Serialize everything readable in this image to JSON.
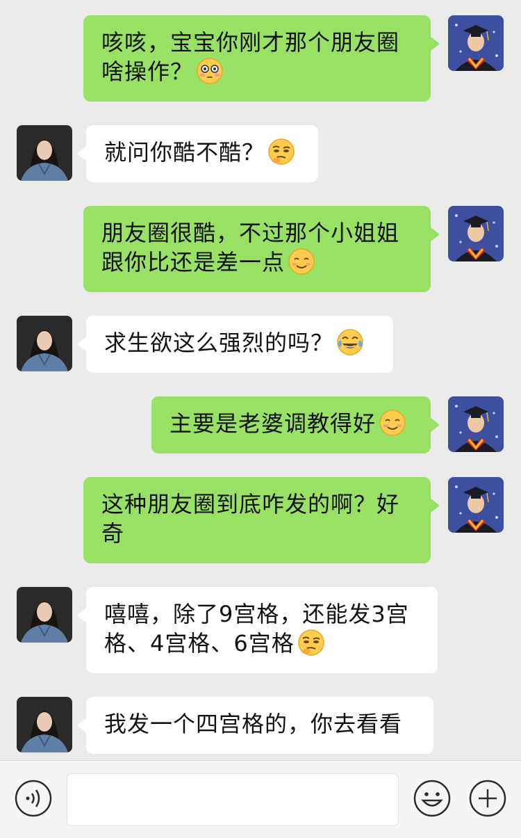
{
  "messages": [
    {
      "side": "me",
      "text": "咳咳，宝宝你刚才那个朋友圈啥操作？",
      "emoji": "flushed-face-icon"
    },
    {
      "side": "other",
      "text": "就问你酷不酷？",
      "emoji": "thinking-face-icon"
    },
    {
      "side": "me",
      "text": "朋友圈很酷，不过那个小姐姐跟你比还是差一点",
      "emoji": "smiling-face-icon"
    },
    {
      "side": "other",
      "text": "求生欲这么强烈的吗？",
      "emoji": "tears-of-joy-face-icon"
    },
    {
      "side": "me",
      "text": "主要是老婆调教得好",
      "emoji": "smiling-face-icon"
    },
    {
      "side": "me",
      "text": "这种朋友圈到底咋发的啊？好奇",
      "emoji": ""
    },
    {
      "side": "other",
      "text": "嘻嘻，除了9宫格，还能发3宫格、4宫格、6宫格",
      "emoji": "thinking-face-icon"
    },
    {
      "side": "other",
      "text": "我发一个四宫格的，你去看看",
      "emoji": ""
    }
  ],
  "input_bar": {
    "voice_icon": "voice-icon",
    "input_value": "",
    "emoji_icon": "emoji-smile-icon",
    "plus_icon": "plus-icon"
  },
  "colors": {
    "background": "#ebebeb",
    "my_bubble": "#98e165",
    "other_bubble": "#ffffff",
    "input_bar": "#f5f5f7"
  }
}
